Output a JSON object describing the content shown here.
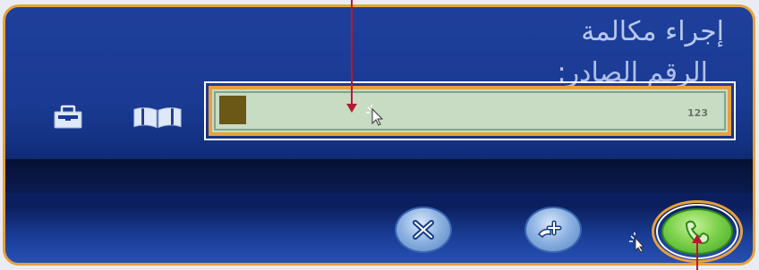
{
  "dialog": {
    "title": "إجراء مكالمة",
    "number_label": "الرقم الصادر:"
  },
  "input": {
    "value": "123"
  },
  "icons": {
    "left_1": "dialpad-icon",
    "left_2": "phonebook-icon",
    "cursor": "mouse-cursor-icon"
  },
  "buttons": {
    "close": "close-icon",
    "transfer": "transfer-call-icon",
    "call": "phone-call-icon"
  },
  "colors": {
    "accent": "#e8a13a",
    "panel_blue": "#1a3a93",
    "input_bg": "#c8dcc4",
    "call_green": "#7fd24c",
    "pointer_red": "#b41a35"
  }
}
